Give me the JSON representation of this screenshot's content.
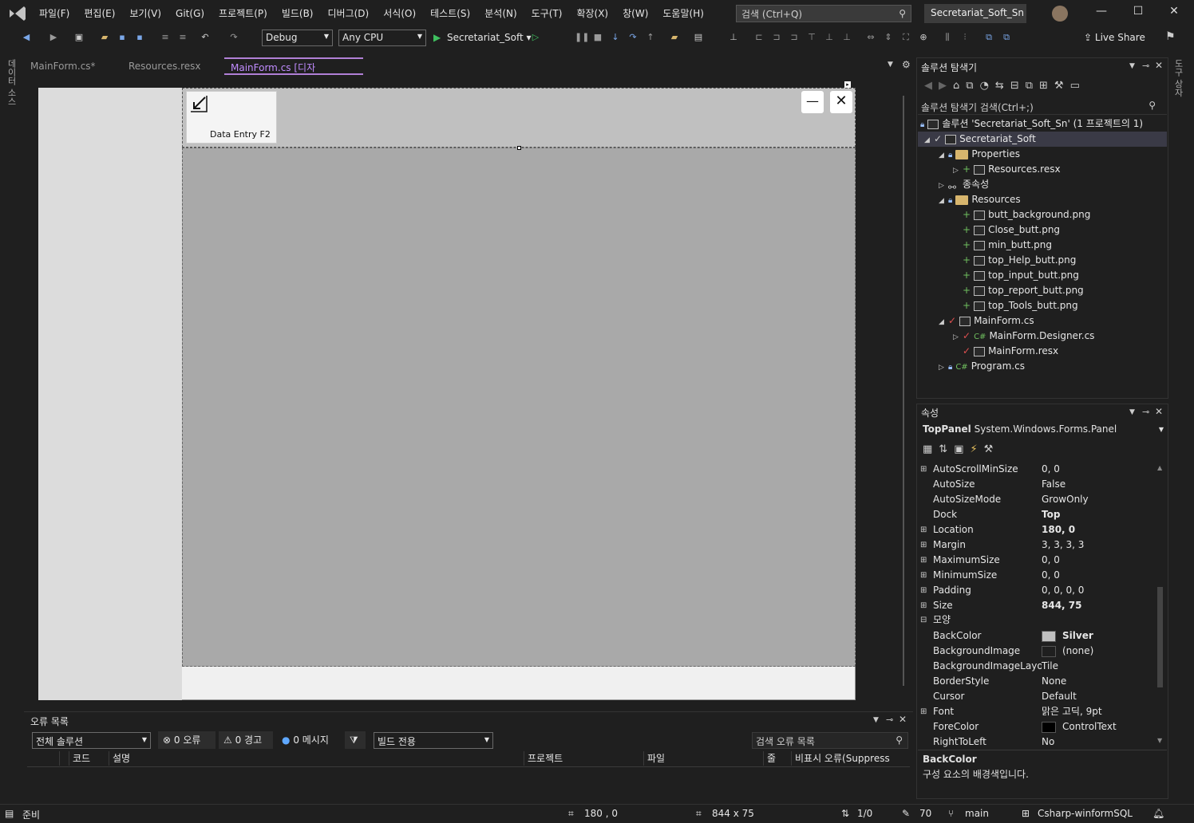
{
  "menubar": {
    "items": [
      "파일(F)",
      "편집(E)",
      "보기(V)",
      "Git(G)",
      "프로젝트(P)",
      "빌드(B)",
      "디버그(D)",
      "서식(O)",
      "테스트(S)",
      "분석(N)",
      "도구(T)",
      "확장(X)",
      "창(W)",
      "도움말(H)"
    ],
    "search_placeholder": "검색 (Ctrl+Q)",
    "solution_title": "Secretariat_Soft_Sn"
  },
  "toolbar": {
    "config": "Debug",
    "platform": "Any CPU",
    "run_target": "Secretariat_Soft",
    "live_share": "Live Share"
  },
  "left_strip": {
    "label": "데이터 소스"
  },
  "right_strip": {
    "label": "도구 상자"
  },
  "tabs": [
    {
      "label": "MainForm.cs*"
    },
    {
      "label": "Resources.resx"
    },
    {
      "label": "MainForm.cs [디자인]*"
    }
  ],
  "designer": {
    "data_entry_label": "Data Entry F2",
    "min_glyph": "—",
    "close_glyph": "✕"
  },
  "error_list": {
    "title": "오류 목록",
    "scope": "전체 솔루션",
    "errors": "0 오류",
    "warnings": "0 경고",
    "messages": "0 메시지",
    "build_filter": "빌드 전용",
    "search_placeholder": "검색 오류 목록",
    "columns": [
      "코드",
      "설명",
      "프로젝트",
      "파일",
      "줄",
      "비표시 오류(Suppress"
    ]
  },
  "solution_explorer": {
    "title": "솔루션 탐색기",
    "search_placeholder": "솔루션 탐색기 검색(Ctrl+;)",
    "solution_label": "솔루션 'Secretariat_Soft_Sn' (1 프로젝트의 1)",
    "project": "Secretariat_Soft",
    "nodes": {
      "properties": "Properties",
      "resources_resx": "Resources.resx",
      "dependencies": "종속성",
      "resources": "Resources",
      "files": [
        "butt_background.png",
        "Close_butt.png",
        "min_butt.png",
        "top_Help_butt.png",
        "top_input_butt.png",
        "top_report_butt.png",
        "top_Tools_butt.png"
      ],
      "mainform": "MainForm.cs",
      "designer": "MainForm.Designer.cs",
      "mainform_resx": "MainForm.resx",
      "program": "Program.cs"
    }
  },
  "properties": {
    "title": "속성",
    "object_name": "TopPanel",
    "object_type": "System.Windows.Forms.Panel",
    "rows": [
      {
        "name": "AutoScrollMinSize",
        "value": "0, 0",
        "expandable": true
      },
      {
        "name": "AutoSize",
        "value": "False"
      },
      {
        "name": "AutoSizeMode",
        "value": "GrowOnly"
      },
      {
        "name": "Dock",
        "value": "Top",
        "bold": true
      },
      {
        "name": "Location",
        "value": "180, 0",
        "expandable": true,
        "bold": true
      },
      {
        "name": "Margin",
        "value": "3, 3, 3, 3",
        "expandable": true
      },
      {
        "name": "MaximumSize",
        "value": "0, 0",
        "expandable": true
      },
      {
        "name": "MinimumSize",
        "value": "0, 0",
        "expandable": true
      },
      {
        "name": "Padding",
        "value": "0, 0, 0, 0",
        "expandable": true
      },
      {
        "name": "Size",
        "value": "844, 75",
        "expandable": true,
        "bold": true
      }
    ],
    "category": "모양",
    "rows2": [
      {
        "name": "BackColor",
        "value": "Silver",
        "bold": true,
        "swatch": "#c0c0c0"
      },
      {
        "name": "BackgroundImage",
        "value": "(none)",
        "swatch": "#1f1f1f"
      },
      {
        "name": "BackgroundImageLayout",
        "value": "Tile"
      },
      {
        "name": "BorderStyle",
        "value": "None"
      },
      {
        "name": "Cursor",
        "value": "Default"
      },
      {
        "name": "Font",
        "value": "맑은 고딕, 9pt",
        "expandable": true
      },
      {
        "name": "ForeColor",
        "value": "ControlText",
        "swatch": "#000000"
      },
      {
        "name": "RightToLeft",
        "value": "No"
      }
    ],
    "desc_title": "BackColor",
    "desc_text": "구성 요소의 배경색입니다."
  },
  "statusbar": {
    "ready": "준비",
    "position": "180 , 0",
    "size": "844 x 75",
    "sync": "1/0",
    "edits": "70",
    "branch": "main",
    "repo": "Csharp-winformSQL"
  },
  "colors": {
    "accent": "#b180d7",
    "bg": "#1f1f1f",
    "silver": "#c0c0c0",
    "darkgray": "#a9a9a9"
  }
}
